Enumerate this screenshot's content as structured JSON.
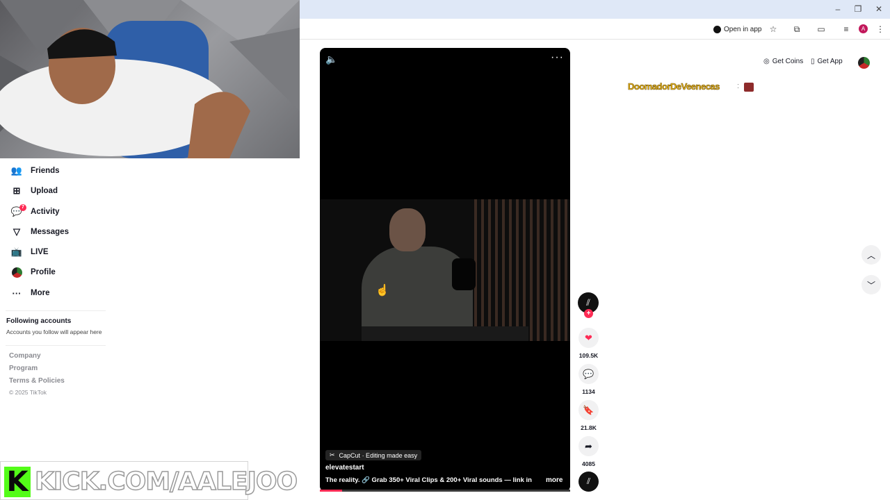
{
  "browser": {
    "open_in_app_label": "Open in app",
    "profile_initial": "A",
    "window_controls": {
      "minimize": "–",
      "restore": "❐",
      "close": "✕"
    }
  },
  "sidebar": {
    "items": [
      {
        "label": "Friends",
        "icon": "friends-icon",
        "glyph": "👥"
      },
      {
        "label": "Upload",
        "icon": "upload-icon",
        "glyph": "⊞"
      },
      {
        "label": "Activity",
        "icon": "activity-icon",
        "glyph": "💬"
      },
      {
        "label": "Messages",
        "icon": "messages-icon",
        "glyph": "▽"
      },
      {
        "label": "LIVE",
        "icon": "live-icon",
        "glyph": "📺"
      },
      {
        "label": "Profile",
        "icon": "profile-avatar-icon",
        "glyph": "●"
      },
      {
        "label": "More",
        "icon": "more-dots-icon",
        "glyph": "···"
      }
    ],
    "activity_badge": "7",
    "following_title": "Following accounts",
    "following_subtitle": "Accounts you follow will appear here",
    "footer_links": [
      "Company",
      "Program",
      "Terms & Policies"
    ],
    "copyright": "© 2025 TikTok"
  },
  "kick_banner": {
    "logo_letter": "K",
    "text": "KICK.COM/AALEJOO"
  },
  "video": {
    "capcut_label": "CapCut · Editing made easy",
    "author": "elevatestart",
    "caption": "The reality.  🔗 Grab 350+ Viral Clips & 200+ Viral sounds — link in ...",
    "more_label": "more",
    "progress": 0.09
  },
  "actions": {
    "likes": "109.5K",
    "comments": "1134",
    "bookmarks": "21.8K",
    "shares": "4085"
  },
  "header": {
    "get_coins_label": "Get Coins",
    "get_app_label": "Get App"
  },
  "overlay": {
    "donor_name": "DoomadorDeVeenecas"
  },
  "colors": {
    "accent": "#fe2c55",
    "kick_green": "#53fc18",
    "donor_gold": "#f6c21c"
  }
}
